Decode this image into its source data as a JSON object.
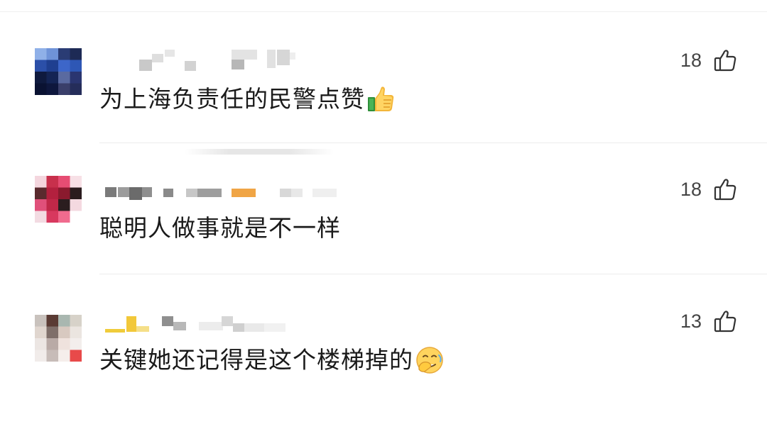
{
  "comments": [
    {
      "text": "为上海负责任的民警点赞",
      "emoji": "thumbs-up-emoji",
      "likes": "18"
    },
    {
      "text": "聪明人做事就是不一样",
      "emoji": "",
      "likes": "18"
    },
    {
      "text": "关键她还记得是这个楼梯掉的",
      "emoji": "face-palm-emoji",
      "likes": "13"
    }
  ],
  "icons": {
    "like": "thumbs-up-outline-icon"
  },
  "colors": {
    "text": "#1a1a1a",
    "meta": "#444444",
    "divider": "#ececec"
  }
}
